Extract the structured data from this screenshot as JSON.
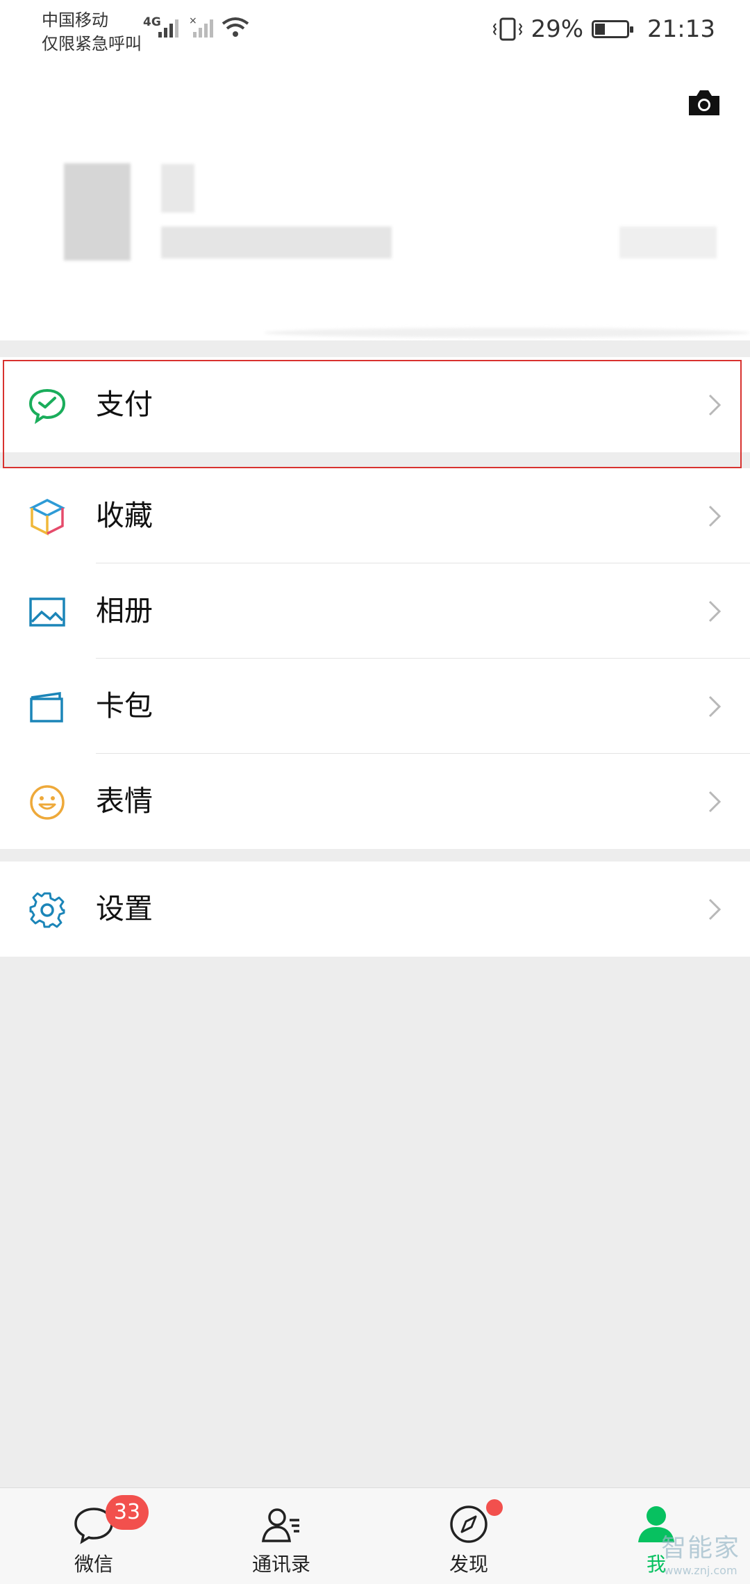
{
  "status_bar": {
    "carrier_line1": "中国移动",
    "carrier_line2": "仅限紧急呼叫",
    "network": "4G",
    "battery": "29%",
    "time": "21:13"
  },
  "menu": {
    "group1": [
      {
        "label": "支付",
        "icon": "wechat-pay-icon"
      }
    ],
    "group2": [
      {
        "label": "收藏",
        "icon": "favorites-cube-icon"
      },
      {
        "label": "相册",
        "icon": "album-picture-icon"
      },
      {
        "label": "卡包",
        "icon": "card-wallet-icon"
      },
      {
        "label": "表情",
        "icon": "smiley-icon"
      }
    ],
    "group3": [
      {
        "label": "设置",
        "icon": "gear-icon"
      }
    ]
  },
  "tabbar": {
    "tabs": [
      {
        "label": "微信",
        "icon": "chat-bubble-icon",
        "badge": "33"
      },
      {
        "label": "通讯录",
        "icon": "contacts-icon"
      },
      {
        "label": "发现",
        "icon": "compass-icon"
      },
      {
        "label": "我",
        "icon": "person-icon"
      }
    ]
  },
  "watermark": {
    "line1": "智能家",
    "line2": "www.znj.com"
  },
  "colors": {
    "accent": "#07c160",
    "badge": "#f2504d",
    "highlight": "#d8322f"
  }
}
